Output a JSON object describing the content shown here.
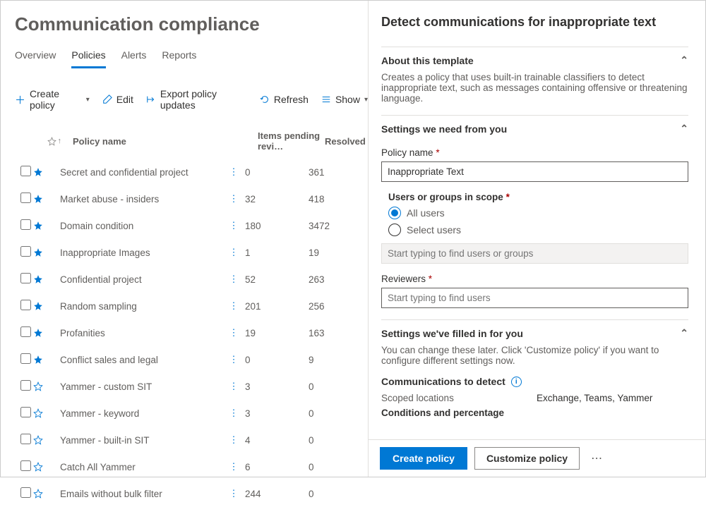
{
  "page_title": "Communication compliance",
  "tabs": [
    "Overview",
    "Policies",
    "Alerts",
    "Reports"
  ],
  "active_tab": 1,
  "toolbar": {
    "create": "Create policy",
    "edit": "Edit",
    "export": "Export policy updates",
    "refresh": "Refresh",
    "show": "Show"
  },
  "columns": {
    "name": "Policy name",
    "pending": "Items pending revi…",
    "resolved": "Resolved"
  },
  "rows": [
    {
      "star": "filled",
      "name": "Secret and confidential project",
      "pending": "0",
      "resolved": "361"
    },
    {
      "star": "filled",
      "name": "Market abuse - insiders",
      "pending": "32",
      "resolved": "418"
    },
    {
      "star": "filled",
      "name": "Domain condition",
      "pending": "180",
      "resolved": "3472"
    },
    {
      "star": "filled",
      "name": "Inappropriate Images",
      "pending": "1",
      "resolved": "19"
    },
    {
      "star": "filled",
      "name": "Confidential project",
      "pending": "52",
      "resolved": "263"
    },
    {
      "star": "filled",
      "name": "Random sampling",
      "pending": "201",
      "resolved": "256"
    },
    {
      "star": "filled",
      "name": "Profanities",
      "pending": "19",
      "resolved": "163"
    },
    {
      "star": "filled",
      "name": "Conflict sales and legal",
      "pending": "0",
      "resolved": "9"
    },
    {
      "star": "outline",
      "name": "Yammer - custom SIT",
      "pending": "3",
      "resolved": "0"
    },
    {
      "star": "outline",
      "name": "Yammer - keyword",
      "pending": "3",
      "resolved": "0"
    },
    {
      "star": "outline",
      "name": "Yammer - built-in SIT",
      "pending": "4",
      "resolved": "0"
    },
    {
      "star": "outline",
      "name": "Catch All Yammer",
      "pending": "6",
      "resolved": "0"
    },
    {
      "star": "outline",
      "name": "Emails without bulk filter",
      "pending": "244",
      "resolved": "0"
    }
  ],
  "panel": {
    "title": "Detect communications for inappropriate text",
    "about_head": "About this template",
    "about_body": "Creates a policy that uses built-in trainable classifiers to detect inappropriate text, such as messages containing offensive or threatening language.",
    "settings_need_head": "Settings we need from you",
    "policy_name_label": "Policy name",
    "policy_name_value": "Inappropriate Text",
    "scope_label": "Users or groups in scope",
    "scope_all": "All users",
    "scope_select": "Select users",
    "scope_placeholder": "Start typing to find users or groups",
    "reviewers_label": "Reviewers",
    "reviewers_placeholder": "Start typing to find users",
    "filled_head": "Settings we've filled in for you",
    "filled_body": "You can change these later. Click 'Customize policy' if you want to configure different settings now.",
    "comm_head": "Communications to detect",
    "scoped_label": "Scoped locations",
    "scoped_value": "Exchange, Teams, Yammer",
    "conditions_label": "Conditions and percentage",
    "create_btn": "Create policy",
    "customize_btn": "Customize policy"
  }
}
